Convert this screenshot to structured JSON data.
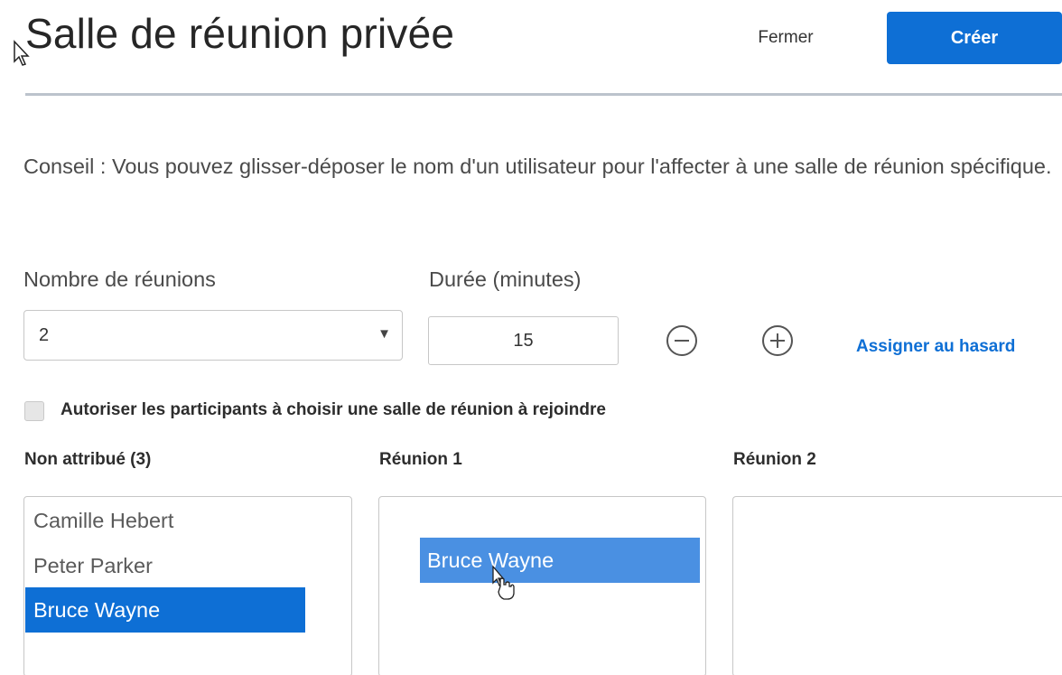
{
  "header": {
    "title": "Salle de réunion privée",
    "close_label": "Fermer",
    "create_label": "Créer"
  },
  "tip": "Conseil : Vous pouvez glisser-déposer le nom d'un utilisateur pour l'affecter à une salle de réunion spécifique.",
  "settings": {
    "rooms_label": "Nombre de réunions",
    "rooms_value": "2",
    "duration_label": "Durée (minutes)",
    "duration_value": "15",
    "random_assign_label": "Assigner au hasard"
  },
  "allow_choose": {
    "label": "Autoriser les participants à choisir une salle de réunion à rejoindre",
    "checked": false
  },
  "columns": {
    "unassigned": {
      "title": "Non attribué (3)",
      "users": [
        "Camille Hebert",
        "Peter Parker",
        "Bruce Wayne"
      ]
    },
    "room1": {
      "title": "Réunion 1",
      "dragging_user": "Bruce Wayne"
    },
    "room2": {
      "title": "Réunion 2"
    }
  },
  "colors": {
    "primary": "#0e6fd5",
    "drag_ghost": "#4a90e2",
    "divider": "#bcc3cc"
  },
  "icons": [
    "minus-circle-icon",
    "plus-circle-icon",
    "dropdown-arrow-icon",
    "arrow-cursor-icon",
    "hand-cursor-icon"
  ]
}
